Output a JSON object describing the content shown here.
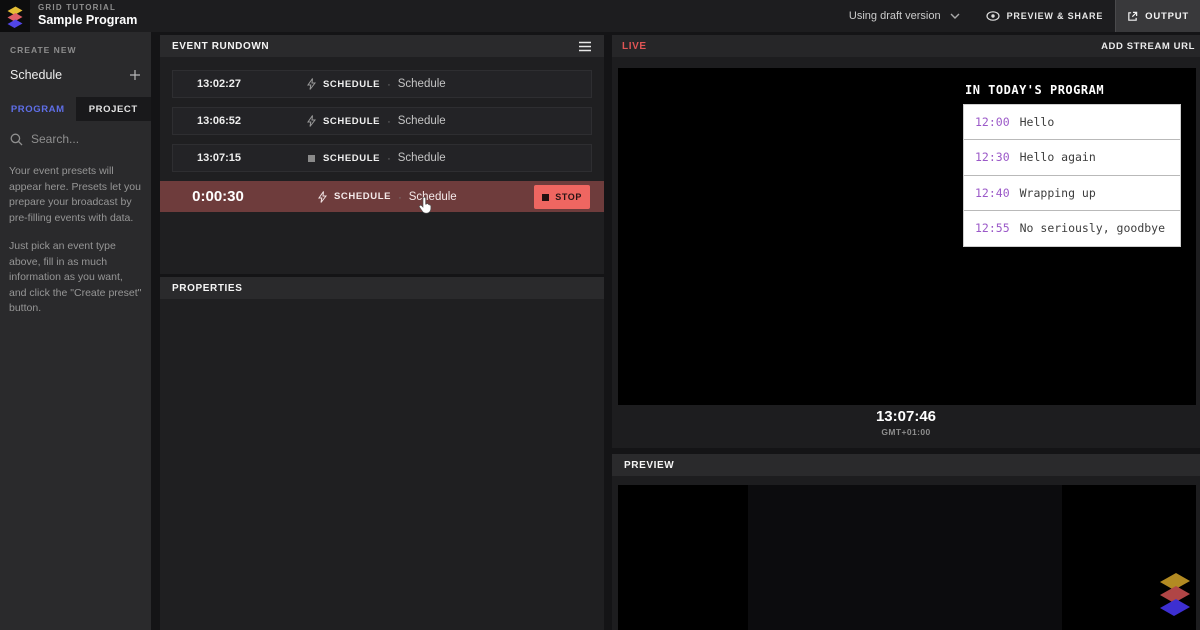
{
  "topbar": {
    "project_label": "GRID TUTORIAL",
    "title": "Sample Program",
    "version_label": "Using draft version",
    "preview_share_label": "PREVIEW & SHARE",
    "output_label": "OUTPUT",
    "icons": [
      "app-logo",
      "chevron-down-icon",
      "eye-icon",
      "external-link-icon"
    ]
  },
  "sidebar": {
    "create_new_label": "CREATE NEW",
    "schedule_item": "Schedule",
    "plus_icon": "plus-icon",
    "tabs": [
      {
        "label": "PROGRAM",
        "active": true
      },
      {
        "label": "PROJECT",
        "active": false
      }
    ],
    "search_placeholder": "Search...",
    "help_paragraphs": [
      "Your event presets will appear here. Presets let you prepare your broadcast by pre-filling events with data.",
      "Just pick an event type above, fill in as much information as you want, and click the \"Create preset\" button."
    ]
  },
  "rundown": {
    "title": "EVENT RUNDOWN",
    "menu_icon": "hamburger-menu-icon",
    "rows": [
      {
        "time": "13:02:27",
        "icon": "lightning-icon",
        "type": "SCHEDULE",
        "name": "Schedule",
        "active": false
      },
      {
        "time": "13:06:52",
        "icon": "lightning-icon",
        "type": "SCHEDULE",
        "name": "Schedule",
        "active": false
      },
      {
        "time": "13:07:15",
        "icon": "square-icon",
        "type": "SCHEDULE",
        "name": "Schedule",
        "active": false
      },
      {
        "time": "0:00:30",
        "icon": "lightning-icon",
        "type": "SCHEDULE",
        "name": "Schedule",
        "active": true,
        "action_label": "STOP"
      }
    ]
  },
  "properties": {
    "title": "PROPERTIES"
  },
  "live": {
    "title": "LIVE",
    "add_stream_label": "ADD STREAM URL",
    "program_overlay": {
      "title": "IN TODAY'S PROGRAM",
      "items": [
        {
          "time": "12:00",
          "label": "Hello"
        },
        {
          "time": "12:30",
          "label": "Hello again"
        },
        {
          "time": "12:40",
          "label": "Wrapping up"
        },
        {
          "time": "12:55",
          "label": "No seriously, goodbye"
        }
      ]
    },
    "clock": {
      "time": "13:07:46",
      "timezone": "GMT+01:00"
    }
  },
  "preview": {
    "title": "PREVIEW"
  },
  "colors": {
    "accent_blue": "#5f6fe8",
    "live_red": "#e05555",
    "active_row_red": "#6e3c3c",
    "stop_button_red": "#ef6661",
    "overlay_time_purple": "#9b59c8",
    "panel_header_bg": "#2a2a2c",
    "panel_body_bg": "#1f1f21",
    "sidebar_bg": "#2a2a2c",
    "topbar_bg": "#1d1d1f"
  }
}
